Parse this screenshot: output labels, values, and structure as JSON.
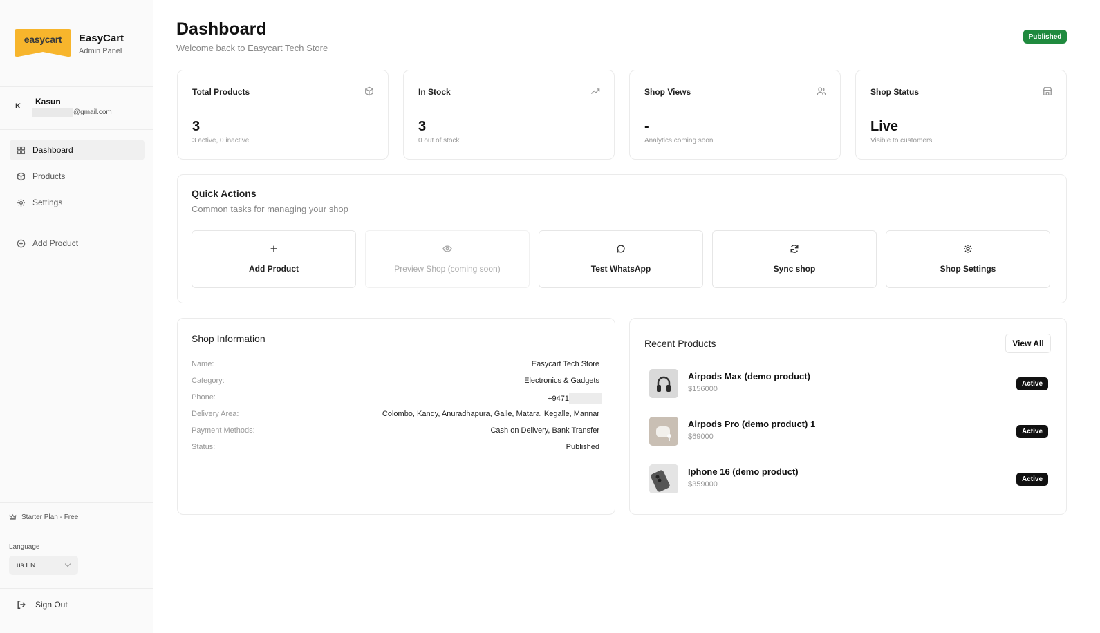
{
  "brand": {
    "logo_text": "easycart",
    "name": "EasyCart",
    "subtitle": "Admin Panel",
    "logo_color": "#f7b52c"
  },
  "user": {
    "initial": "K",
    "name": "Kasun",
    "email_visible": "@gmail.com"
  },
  "nav": {
    "items": [
      {
        "label": "Dashboard",
        "icon": "grid-icon",
        "active": true
      },
      {
        "label": "Products",
        "icon": "package-icon",
        "active": false
      },
      {
        "label": "Settings",
        "icon": "gear-icon",
        "active": false
      }
    ],
    "add_product": {
      "label": "Add Product",
      "icon": "plus-circle-icon"
    }
  },
  "plan": {
    "label": "Starter Plan - Free",
    "icon": "crown-icon"
  },
  "language": {
    "label": "Language",
    "selected": "us EN"
  },
  "sign_out": {
    "label": "Sign Out",
    "icon": "logout-icon"
  },
  "header": {
    "title": "Dashboard",
    "subtitle": "Welcome back to Easycart Tech Store",
    "status_badge": "Published",
    "status_color": "#1f8a3e"
  },
  "stats": [
    {
      "label": "Total Products",
      "value": "3",
      "hint": "3 active, 0 inactive",
      "icon": "package-icon"
    },
    {
      "label": "In Stock",
      "value": "3",
      "hint": "0 out of stock",
      "icon": "trending-up-icon"
    },
    {
      "label": "Shop Views",
      "value": "-",
      "hint": "Analytics coming soon",
      "icon": "users-icon"
    },
    {
      "label": "Shop Status",
      "value": "Live",
      "hint": "Visible to customers",
      "icon": "store-icon"
    }
  ],
  "quick_actions": {
    "title": "Quick Actions",
    "subtitle": "Common tasks for managing your shop",
    "buttons": [
      {
        "label": "Add Product",
        "icon": "plus-icon",
        "disabled": false
      },
      {
        "label": "Preview Shop (coming soon)",
        "icon": "eye-icon",
        "disabled": true
      },
      {
        "label": "Test WhatsApp",
        "icon": "message-circle-icon",
        "disabled": false
      },
      {
        "label": "Sync shop",
        "icon": "refresh-icon",
        "disabled": false
      },
      {
        "label": "Shop Settings",
        "icon": "gear-icon",
        "disabled": false
      }
    ]
  },
  "shop_info": {
    "title": "Shop Information",
    "rows": [
      {
        "key": "Name:",
        "value": "Easycart Tech Store"
      },
      {
        "key": "Category:",
        "value": "Electronics & Gadgets"
      },
      {
        "key": "Phone:",
        "value": "+9471"
      },
      {
        "key": "Delivery Area:",
        "value": "Colombo, Kandy, Anuradhapura, Galle, Matara, Kegalle, Mannar"
      },
      {
        "key": "Payment Methods:",
        "value": "Cash on Delivery, Bank Transfer"
      },
      {
        "key": "Status:",
        "value": "Published"
      }
    ]
  },
  "recent_products": {
    "title": "Recent Products",
    "view_all": "View All",
    "items": [
      {
        "name": "Airpods Max (demo product)",
        "price": "$156000",
        "status": "Active",
        "icon": "headphones-icon"
      },
      {
        "name": "Airpods Pro (demo product) 1",
        "price": "$69000",
        "status": "Active",
        "icon": "earbuds-icon"
      },
      {
        "name": "Iphone 16 (demo product)",
        "price": "$359000",
        "status": "Active",
        "icon": "phone-icon"
      }
    ]
  }
}
